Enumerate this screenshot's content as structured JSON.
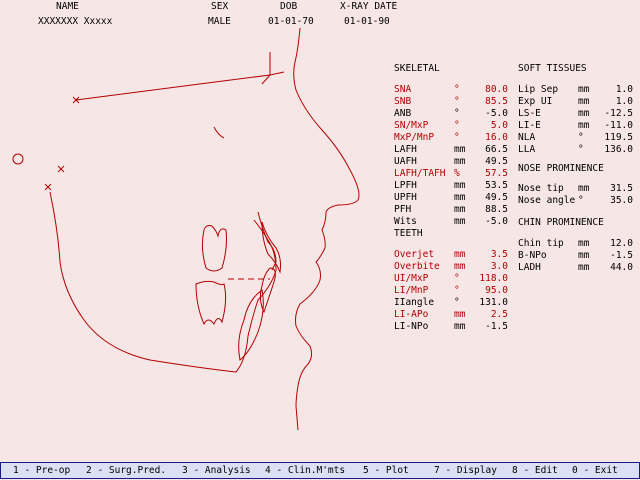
{
  "header": {
    "name_label": "NAME",
    "sex_label": "SEX",
    "dob_label": "DOB",
    "xray_label": "X-RAY DATE",
    "name": "XXXXXXX Xxxxx",
    "sex": "MALE",
    "dob": "01-01-70",
    "xray_date": "01-01-90"
  },
  "colors": {
    "highlight": "#b40000",
    "background": "#f6e6e6",
    "menubar": "#dce0f4"
  },
  "skeletal": {
    "title": "SKELETAL",
    "rows": [
      {
        "label": "SNA",
        "unit": "°",
        "value": "80.0",
        "hl": true
      },
      {
        "label": "SNB",
        "unit": "°",
        "value": "85.5",
        "hl": true
      },
      {
        "label": "ANB",
        "unit": "°",
        "value": "-5.0",
        "hl": false
      },
      {
        "label": "SN/MxP",
        "unit": "°",
        "value": "5.0",
        "hl": true
      },
      {
        "label": "MxP/MnP",
        "unit": "°",
        "value": "16.0",
        "hl": true
      },
      {
        "label": "LAFH",
        "unit": "mm",
        "value": "66.5",
        "hl": false
      },
      {
        "label": "UAFH",
        "unit": "mm",
        "value": "49.5",
        "hl": false
      },
      {
        "label": "LAFH/TAFH",
        "unit": "%",
        "value": "57.5",
        "hl": true
      },
      {
        "label": "LPFH",
        "unit": "mm",
        "value": "53.5",
        "hl": false
      },
      {
        "label": "UPFH",
        "unit": "mm",
        "value": "49.5",
        "hl": false
      },
      {
        "label": "PFH",
        "unit": "mm",
        "value": "88.5",
        "hl": false
      },
      {
        "label": "Wits",
        "unit": "mm",
        "value": "-5.0",
        "hl": false
      }
    ]
  },
  "teeth": {
    "title": "TEETH",
    "rows": [
      {
        "label": "Overjet",
        "unit": "mm",
        "value": "3.5",
        "hl": true
      },
      {
        "label": "Overbite",
        "unit": "mm",
        "value": "3.0",
        "hl": true
      },
      {
        "label": "UI/MxP",
        "unit": "°",
        "value": "118.0",
        "hl": true
      },
      {
        "label": "LI/MnP",
        "unit": "°",
        "value": "95.0",
        "hl": true
      },
      {
        "label": "IIangle",
        "unit": "°",
        "value": "131.0",
        "hl": false
      },
      {
        "label": "LI-APo",
        "unit": "mm",
        "value": "2.5",
        "hl": true
      },
      {
        "label": "LI-NPo",
        "unit": "mm",
        "value": "-1.5",
        "hl": false
      }
    ]
  },
  "soft_tissues": {
    "title": "SOFT TISSUES",
    "rows": [
      {
        "label": "Lip Sep",
        "unit": "mm",
        "value": "1.0"
      },
      {
        "label": "Exp UI",
        "unit": "mm",
        "value": "1.0"
      },
      {
        "label": "LS-E",
        "unit": "mm",
        "value": "-12.5"
      },
      {
        "label": "LI-E",
        "unit": "mm",
        "value": "-11.0"
      },
      {
        "label": "NLA",
        "unit": "°",
        "value": "119.5"
      },
      {
        "label": "LLA",
        "unit": "°",
        "value": "136.0"
      }
    ]
  },
  "nose": {
    "title": "NOSE PROMINENCE",
    "rows": [
      {
        "label": "Nose tip",
        "unit": "mm",
        "value": "31.5"
      },
      {
        "label": "Nose angle",
        "unit": "°",
        "value": "35.0"
      }
    ]
  },
  "chin": {
    "title": "CHIN PROMINENCE",
    "rows": [
      {
        "label": "Chin tip",
        "unit": "mm",
        "value": "12.0"
      },
      {
        "label": "B-NPo",
        "unit": "mm",
        "value": "-1.5"
      },
      {
        "label": "LADH",
        "unit": "mm",
        "value": "44.0"
      }
    ]
  },
  "menu": [
    "1 - Pre-op",
    "2 - Surg.Pred.",
    "3 - Analysis",
    "4 - Clin.M'mts",
    "5 - Plot",
    "7 - Display",
    "8 - Edit",
    "0 - Exit"
  ]
}
